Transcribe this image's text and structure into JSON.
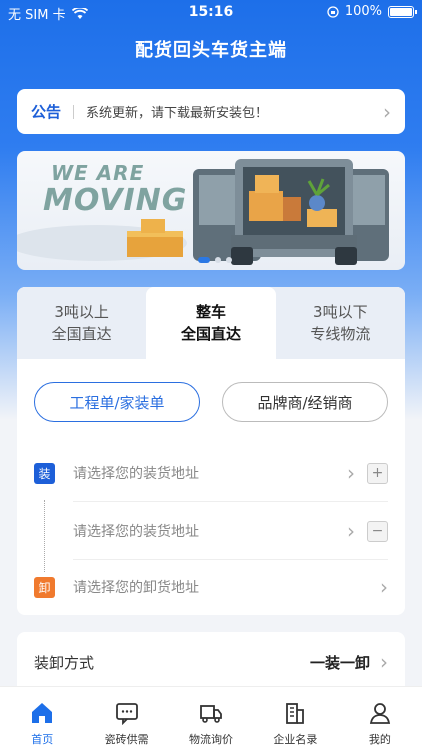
{
  "status": {
    "carrier": "无 SIM 卡",
    "time": "15:16",
    "battery": "100%"
  },
  "header": {
    "title": "配货回头车货主端"
  },
  "notice": {
    "tag": "公告",
    "message": "系统更新，请下载最新安装包！"
  },
  "banner": {
    "line1": "WE ARE",
    "line2": "MOVING"
  },
  "tabs": [
    {
      "line1": "3吨以上",
      "line2": "全国直达"
    },
    {
      "line1": "整车",
      "line2": "全国直达"
    },
    {
      "line1": "3吨以下",
      "line2": "专线物流"
    }
  ],
  "order_types": [
    "工程单/家装单",
    "品牌商/经销商"
  ],
  "address": {
    "load_badge": "装",
    "unload_badge": "卸",
    "load_placeholder": "请选择您的装货地址",
    "load_placeholder_2": "请选择您的装货地址",
    "unload_placeholder": "请选择您的卸货地址"
  },
  "method": {
    "label": "装卸方式",
    "value": "一装一卸"
  },
  "tabbar": [
    {
      "label": "首页"
    },
    {
      "label": "瓷砖供需"
    },
    {
      "label": "物流询价"
    },
    {
      "label": "企业名录"
    },
    {
      "label": "我的"
    }
  ],
  "colors": {
    "primary": "#1d6fe9",
    "unload": "#f07a2e"
  }
}
